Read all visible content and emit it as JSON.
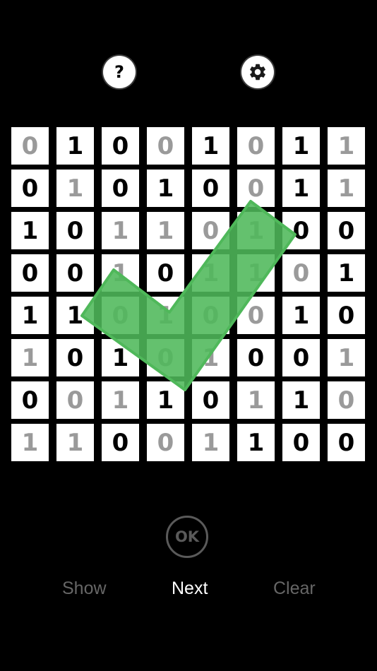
{
  "toolbar": {
    "help_label": "?",
    "settings_icon": "gear-icon"
  },
  "board": {
    "rows": 8,
    "cols": 8,
    "cells": [
      [
        {
          "v": "0",
          "locked": false
        },
        {
          "v": "1",
          "locked": true
        },
        {
          "v": "0",
          "locked": true
        },
        {
          "v": "0",
          "locked": false
        },
        {
          "v": "1",
          "locked": true
        },
        {
          "v": "0",
          "locked": false
        },
        {
          "v": "1",
          "locked": true
        },
        {
          "v": "1",
          "locked": false
        }
      ],
      [
        {
          "v": "0",
          "locked": true
        },
        {
          "v": "1",
          "locked": false
        },
        {
          "v": "0",
          "locked": true
        },
        {
          "v": "1",
          "locked": true
        },
        {
          "v": "0",
          "locked": true
        },
        {
          "v": "0",
          "locked": false
        },
        {
          "v": "1",
          "locked": true
        },
        {
          "v": "1",
          "locked": false
        }
      ],
      [
        {
          "v": "1",
          "locked": true
        },
        {
          "v": "0",
          "locked": true
        },
        {
          "v": "1",
          "locked": false
        },
        {
          "v": "1",
          "locked": false
        },
        {
          "v": "0",
          "locked": false
        },
        {
          "v": "1",
          "locked": false
        },
        {
          "v": "0",
          "locked": true
        },
        {
          "v": "0",
          "locked": true
        }
      ],
      [
        {
          "v": "0",
          "locked": true
        },
        {
          "v": "0",
          "locked": true
        },
        {
          "v": "1",
          "locked": false
        },
        {
          "v": "0",
          "locked": true
        },
        {
          "v": "1",
          "locked": false
        },
        {
          "v": "1",
          "locked": false
        },
        {
          "v": "0",
          "locked": false
        },
        {
          "v": "1",
          "locked": true
        }
      ],
      [
        {
          "v": "1",
          "locked": true
        },
        {
          "v": "1",
          "locked": true
        },
        {
          "v": "0",
          "locked": false
        },
        {
          "v": "1",
          "locked": false
        },
        {
          "v": "0",
          "locked": false
        },
        {
          "v": "0",
          "locked": false
        },
        {
          "v": "1",
          "locked": true
        },
        {
          "v": "0",
          "locked": true
        }
      ],
      [
        {
          "v": "1",
          "locked": false
        },
        {
          "v": "0",
          "locked": true
        },
        {
          "v": "1",
          "locked": true
        },
        {
          "v": "0",
          "locked": false
        },
        {
          "v": "1",
          "locked": false
        },
        {
          "v": "0",
          "locked": true
        },
        {
          "v": "0",
          "locked": true
        },
        {
          "v": "1",
          "locked": false
        }
      ],
      [
        {
          "v": "0",
          "locked": true
        },
        {
          "v": "0",
          "locked": false
        },
        {
          "v": "1",
          "locked": false
        },
        {
          "v": "1",
          "locked": true
        },
        {
          "v": "0",
          "locked": true
        },
        {
          "v": "1",
          "locked": false
        },
        {
          "v": "1",
          "locked": true
        },
        {
          "v": "0",
          "locked": false
        }
      ],
      [
        {
          "v": "1",
          "locked": false
        },
        {
          "v": "1",
          "locked": false
        },
        {
          "v": "0",
          "locked": true
        },
        {
          "v": "0",
          "locked": false
        },
        {
          "v": "1",
          "locked": false
        },
        {
          "v": "1",
          "locked": true
        },
        {
          "v": "0",
          "locked": true
        },
        {
          "v": "0",
          "locked": true
        }
      ]
    ],
    "solved_overlay": "checkmark-icon",
    "solved_color": "#4fb85a"
  },
  "actions": {
    "ok_label": "OK",
    "show_label": "Show",
    "next_label": "Next",
    "clear_label": "Clear"
  }
}
